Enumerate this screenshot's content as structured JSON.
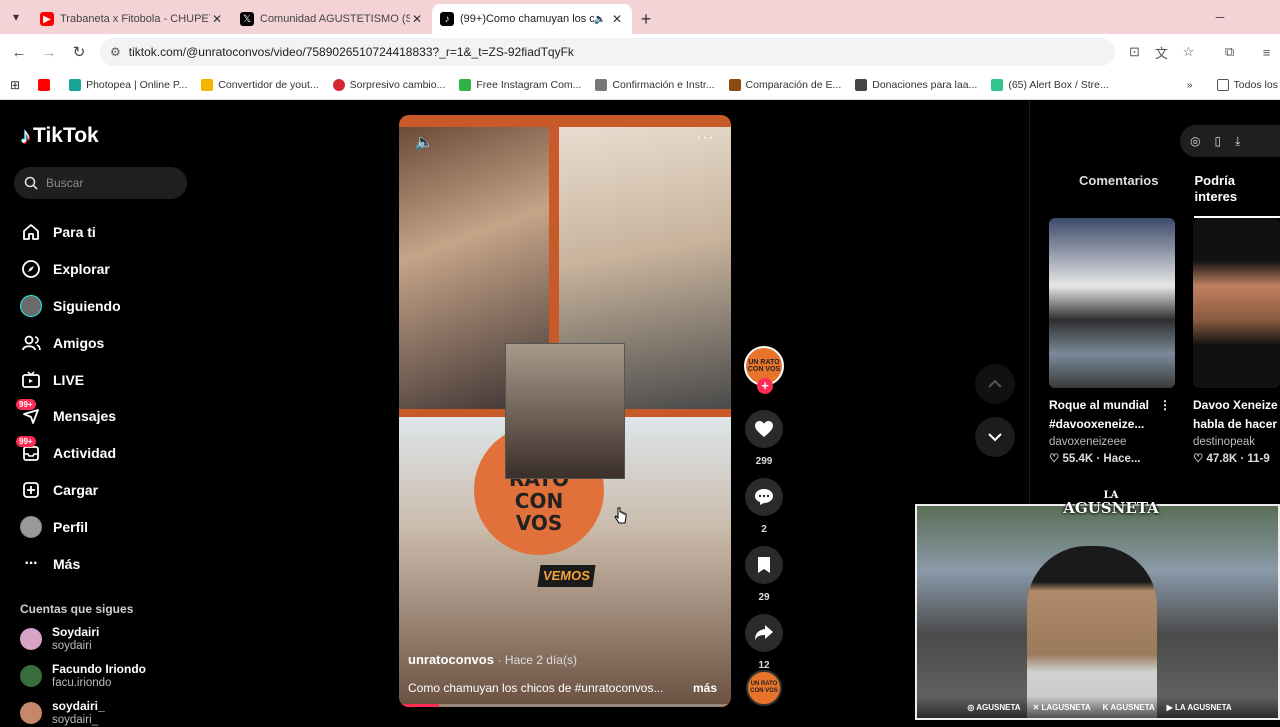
{
  "browser": {
    "tabs": [
      {
        "title": "Trabaneta x Fitobola - CHUPETE",
        "favicon_color": "#ff0000",
        "active": false
      },
      {
        "title": "Comunidad AGUSTETISMO (SU",
        "favicon_color": "#000000",
        "active": false
      },
      {
        "title": "(99+)Como chamuyan los c",
        "favicon_color": "#000000",
        "active": true
      }
    ],
    "url": "tiktok.com/@unratoconvos/video/7589026510724418833?_r=1&_t=ZS-92fiadTqyFk",
    "bookmarks": [
      {
        "label": "",
        "color": "#ff0000"
      },
      {
        "label": "Photopea | Online P...",
        "color": "#18a497"
      },
      {
        "label": "Convertidor de yout...",
        "color": "#f5b400"
      },
      {
        "label": "Sorpresivo cambio...",
        "color": "#d6262e"
      },
      {
        "label": "Free Instagram Com...",
        "color": "#2fb344"
      },
      {
        "label": "Confirmación e Instr...",
        "color": "#777777"
      },
      {
        "label": "Comparación de E...",
        "color": "#8a4a12"
      },
      {
        "label": "Donaciones para laa...",
        "color": "#444444"
      },
      {
        "label": "(65) Alert Box / Stre...",
        "color": "#31c48d"
      }
    ],
    "bookmarks_all": "Todos los m"
  },
  "tiktok": {
    "logo": "TikTok",
    "search_placeholder": "Buscar",
    "nav": [
      {
        "label": "Para ti",
        "icon": "home-icon"
      },
      {
        "label": "Explorar",
        "icon": "compass-icon"
      },
      {
        "label": "Siguiendo",
        "icon": "avatar-icon"
      },
      {
        "label": "Amigos",
        "icon": "friends-icon"
      },
      {
        "label": "LIVE",
        "icon": "live-icon"
      },
      {
        "label": "Mensajes",
        "icon": "message-icon",
        "badge": "99+"
      },
      {
        "label": "Actividad",
        "icon": "inbox-icon",
        "badge": "99+"
      },
      {
        "label": "Cargar",
        "icon": "upload-icon"
      },
      {
        "label": "Perfil",
        "icon": "profile-icon"
      },
      {
        "label": "Más",
        "icon": "more-icon"
      }
    ],
    "following_header": "Cuentas que sigues",
    "following": [
      {
        "name": "Soydairi",
        "handle": "soydairi",
        "color": "#d9a3c7"
      },
      {
        "name": "Facundo Iriondo",
        "handle": "facu.iriondo",
        "color": "#3a6b3a"
      },
      {
        "name": "soydairi_",
        "handle": "soydairi_",
        "color": "#c7876a"
      }
    ],
    "video": {
      "author": "unratoconvos",
      "time": "· Hace 2 día(s)",
      "description": "Como chamuyan los chicos de #unratoconvos...",
      "more": "más",
      "overlay_text_1": "UN RATO CON VOS",
      "overlay_text_2": "VEMOS",
      "progress": 0.12,
      "likes": "299",
      "comments": "2",
      "saves": "29",
      "shares": "12"
    },
    "right_tabs": [
      "Comentarios",
      "Podría interes"
    ],
    "right_videos": [
      {
        "title": "Roque al mundial",
        "title2": "#davooxeneize...",
        "user": "davoxeneizeee",
        "stats": "55.4K · Hace..."
      },
      {
        "title": "Davoo Xeneize",
        "title2": "habla de hacer",
        "user": "destinopeak",
        "stats": "47.8K · 11-9"
      }
    ]
  },
  "webcam": {
    "logo_line1": "LA",
    "logo_line2": "AGUSNETA",
    "socials": [
      "AGUSNETA",
      "LAGUSNETA",
      "AGUSNETA",
      "LA AGUSNETA"
    ]
  },
  "colors": {
    "accent": "#fe2c55",
    "tab_strip": "#f4d3d7"
  }
}
